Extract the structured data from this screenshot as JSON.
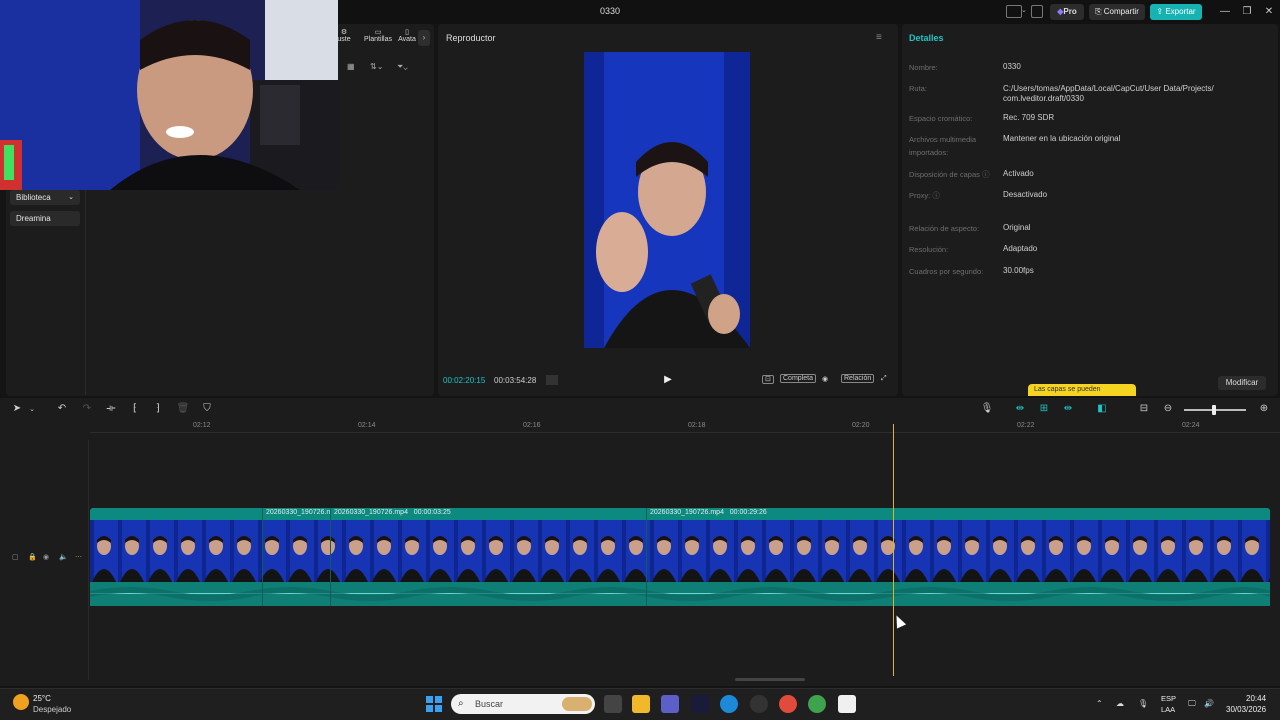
{
  "window": {
    "title": "0330",
    "pro_label": "Pro",
    "share_label": "Compartir",
    "export_label": "Exportar"
  },
  "left_panel": {
    "tabs": [
      "uste",
      "Plantillas",
      "Avata"
    ],
    "nav_items": [
      "Biblioteca",
      "Dreamina"
    ]
  },
  "player": {
    "title": "Reproductor",
    "time_current": "00:02:20:15",
    "time_total": "00:03:54:28",
    "full_label": "Completa",
    "ratio_label": "Relación"
  },
  "details": {
    "title": "Detalles",
    "rows": [
      {
        "label": "Nombre:",
        "value": "0330"
      },
      {
        "label": "Ruta:",
        "value": "C:/Users/tomas/AppData/Local/CapCut/User Data/Projects/ com.lveditor.draft/0330"
      },
      {
        "label": "Espacio cromático:",
        "value": "Rec. 709 SDR"
      },
      {
        "label": "Archivos multimedia importados:",
        "value": "Mantener en la ubicación original"
      },
      {
        "label": "Disposición de capas ⓘ",
        "value": "Activado"
      },
      {
        "label": "Proxy: ⓘ",
        "value": "Desactivado"
      },
      {
        "label": "Relación de aspecto:",
        "value": "Original"
      },
      {
        "label": "Resolución:",
        "value": "Adaptado"
      },
      {
        "label": "Cuadros por segundo:",
        "value": "30.00fps"
      }
    ],
    "hint": "Las capas se pueden",
    "modify_label": "Modificar"
  },
  "timeline": {
    "ruler": [
      "02:12",
      "02:14",
      "02:16",
      "02:18",
      "02:20",
      "02:22",
      "02:24"
    ],
    "clips": [
      {
        "label": "20260330_190726.m"
      },
      {
        "label": "20260330_190726.mp4   00:00:03:25"
      },
      {
        "label": "20260330_190726.mp4   00:00:29:26"
      }
    ]
  },
  "taskbar": {
    "temperature": "25°C",
    "weather": "Despejado",
    "search_placeholder": "Buscar",
    "lang_top": "ESP",
    "lang_bottom": "LAA",
    "time": "20:44",
    "date": "30/03/2026"
  },
  "colors": {
    "accent": "#20c4c4",
    "export": "#17b3b3",
    "track": "#0d8a80",
    "playhead": "#e2b31b"
  }
}
